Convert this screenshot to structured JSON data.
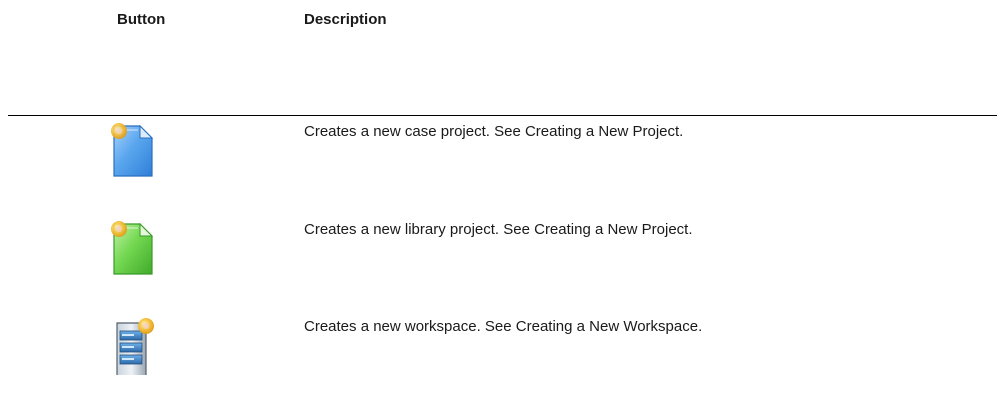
{
  "table": {
    "headers": {
      "button": "Button",
      "description": "Description"
    },
    "rows": [
      {
        "icon": "new-case-project-icon",
        "description": "Creates a new case project. See Creating a New Project."
      },
      {
        "icon": "new-library-project-icon",
        "description": "Creates a new library project. See Creating a New Project."
      },
      {
        "icon": "new-workspace-icon",
        "description": "Creates a new workspace. See Creating a New Workspace."
      }
    ]
  },
  "colors": {
    "case_project": "#3d8ee0",
    "library_project": "#55c83c",
    "workspace": "#3a78b8",
    "new_badge": "#f2b72a",
    "rule": "#000000"
  }
}
